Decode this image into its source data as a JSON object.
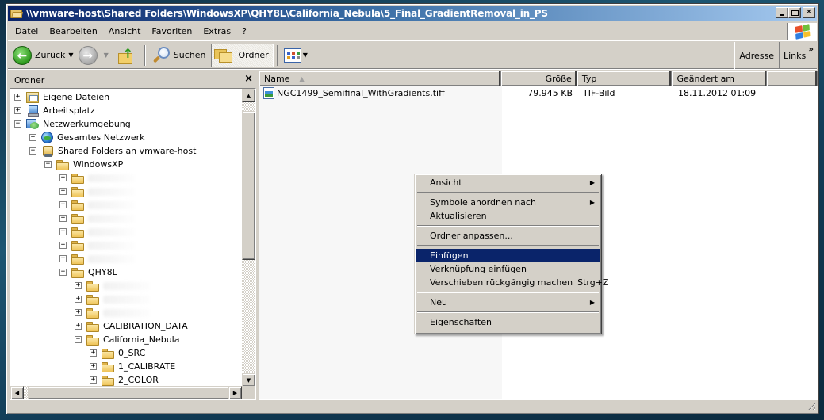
{
  "window": {
    "title": "\\\\vmware-host\\Shared Folders\\WindowsXP\\QHY8L\\California_Nebula\\5_Final_GradientRemoval_in_PS"
  },
  "menubar": {
    "items": [
      "Datei",
      "Bearbeiten",
      "Ansicht",
      "Favoriten",
      "Extras",
      "?"
    ]
  },
  "toolbar": {
    "back_label": "Zurück",
    "search_label": "Suchen",
    "folders_label": "Ordner",
    "address_label": "Adresse",
    "links_label": "Links",
    "links_overflow": "»"
  },
  "folder_pane": {
    "title": "Ordner",
    "close_glyph": "×",
    "tree": [
      {
        "label": "Eigene Dateien",
        "expander": "+",
        "icon": "my-documents-icon",
        "level": 0
      },
      {
        "label": "Arbeitsplatz",
        "expander": "+",
        "icon": "my-computer-icon",
        "level": 0
      },
      {
        "label": "Netzwerkumgebung",
        "expander": "−",
        "icon": "network-places-icon",
        "level": 0
      },
      {
        "label": "Gesamtes Netzwerk",
        "expander": "+",
        "icon": "entire-network-icon",
        "level": 1
      },
      {
        "label": "Shared Folders an vmware-host",
        "expander": "−",
        "icon": "shared-folder-icon",
        "level": 1
      },
      {
        "label": "WindowsXP",
        "expander": "−",
        "icon": "folder-icon",
        "level": 2
      },
      {
        "label": "",
        "expander": "+",
        "icon": "folder-icon",
        "level": 3,
        "redacted": true
      },
      {
        "label": "",
        "expander": "+",
        "icon": "folder-icon",
        "level": 3,
        "redacted": true
      },
      {
        "label": "",
        "expander": "+",
        "icon": "folder-icon",
        "level": 3,
        "redacted": true
      },
      {
        "label": "",
        "expander": "+",
        "icon": "folder-icon",
        "level": 3,
        "redacted": true
      },
      {
        "label": "",
        "expander": "+",
        "icon": "folder-icon",
        "level": 3,
        "redacted": true
      },
      {
        "label": "",
        "expander": "+",
        "icon": "folder-icon",
        "level": 3,
        "redacted": true
      },
      {
        "label": "",
        "expander": "+",
        "icon": "folder-icon",
        "level": 3,
        "redacted": true
      },
      {
        "label": "QHY8L",
        "expander": "−",
        "icon": "folder-icon",
        "level": 3
      },
      {
        "label": "",
        "expander": "+",
        "icon": "folder-icon",
        "level": 4,
        "redacted": true
      },
      {
        "label": "",
        "expander": "+",
        "icon": "folder-icon",
        "level": 4,
        "redacted": true
      },
      {
        "label": "",
        "expander": "+",
        "icon": "folder-icon",
        "level": 4,
        "redacted": true
      },
      {
        "label": "CALIBRATION_DATA",
        "expander": "+",
        "icon": "folder-icon",
        "level": 4
      },
      {
        "label": "California_Nebula",
        "expander": "−",
        "icon": "folder-icon",
        "level": 4
      },
      {
        "label": "0_SRC",
        "expander": "+",
        "icon": "folder-icon",
        "level": 5
      },
      {
        "label": "1_CALIBRATE",
        "expander": "+",
        "icon": "folder-icon",
        "level": 5
      },
      {
        "label": "2_COLOR",
        "expander": "+",
        "icon": "folder-icon",
        "level": 5
      }
    ]
  },
  "file_list": {
    "columns": [
      {
        "label": "Name",
        "sorted": "ascending"
      },
      {
        "label": "Größe",
        "align": "right"
      },
      {
        "label": "Typ"
      },
      {
        "label": "Geändert am"
      },
      {
        "label": ""
      }
    ],
    "rows": [
      {
        "name": "NGC1499_Semifinal_WithGradients.tiff",
        "size": "79.945 KB",
        "type": "TIF-Bild",
        "modified": "18.11.2012 01:09"
      }
    ]
  },
  "context_menu": {
    "groups": [
      [
        {
          "label": "Ansicht",
          "submenu": true
        }
      ],
      [
        {
          "label": "Symbole anordnen nach",
          "submenu": true
        },
        {
          "label": "Aktualisieren"
        }
      ],
      [
        {
          "label": "Ordner anpassen..."
        }
      ],
      [
        {
          "label": "Einfügen",
          "highlighted": true
        },
        {
          "label": "Verknüpfung einfügen"
        },
        {
          "label": "Verschieben rückgängig machen",
          "shortcut": "Strg+Z"
        }
      ],
      [
        {
          "label": "Neu",
          "submenu": true
        }
      ],
      [
        {
          "label": "Eigenschaften"
        }
      ]
    ]
  },
  "colors": {
    "title_gradient_start": "#0a246a",
    "title_gradient_end": "#a6caf0",
    "menu_highlight": "#0a246a",
    "chrome": "#d4d0c8",
    "sorted_column_tint": "#f7f7f7"
  }
}
